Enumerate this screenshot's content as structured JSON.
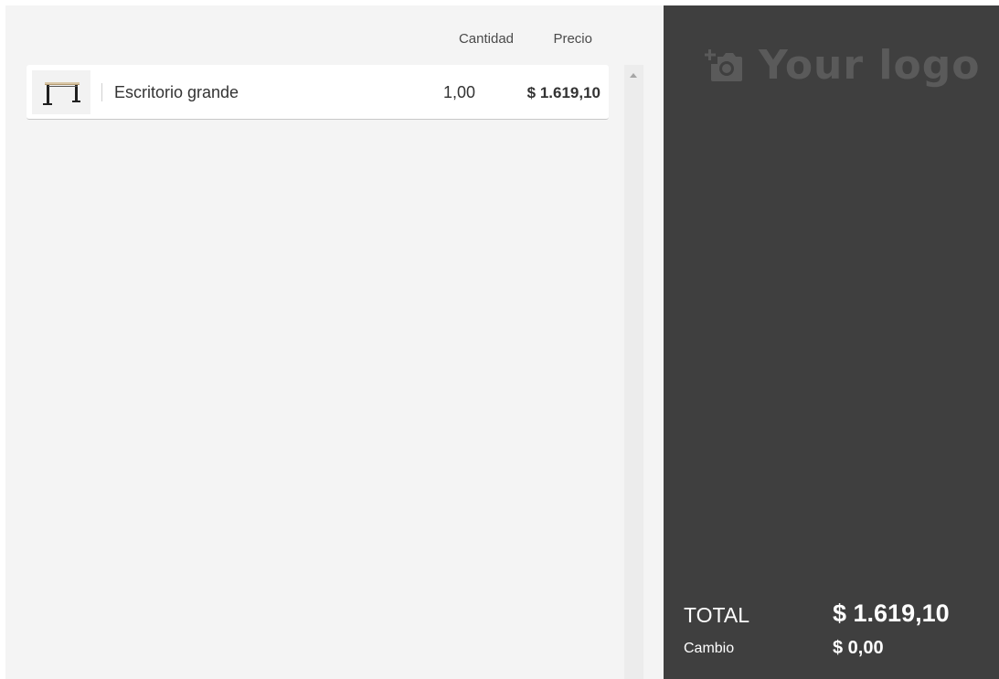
{
  "order": {
    "columns": {
      "quantity": "Cantidad",
      "price": "Precio"
    },
    "lines": [
      {
        "product_name": "Escritorio grande",
        "quantity": "1,00",
        "price": "$ 1.619,10",
        "thumbnail_icon": "desk-icon"
      }
    ]
  },
  "summary": {
    "logo_text": "Your logo",
    "logo_icon": "add-photo-icon",
    "total_label": "TOTAL",
    "total_value": "$ 1.619,10",
    "change_label": "Cambio",
    "change_value": "$ 0,00"
  },
  "colors": {
    "order_background": "#f4f4f4",
    "summary_background": "#3f3f3f",
    "logo_placeholder": "#5a5a5a",
    "text_dark": "#333333",
    "text_light": "#ffffff"
  }
}
